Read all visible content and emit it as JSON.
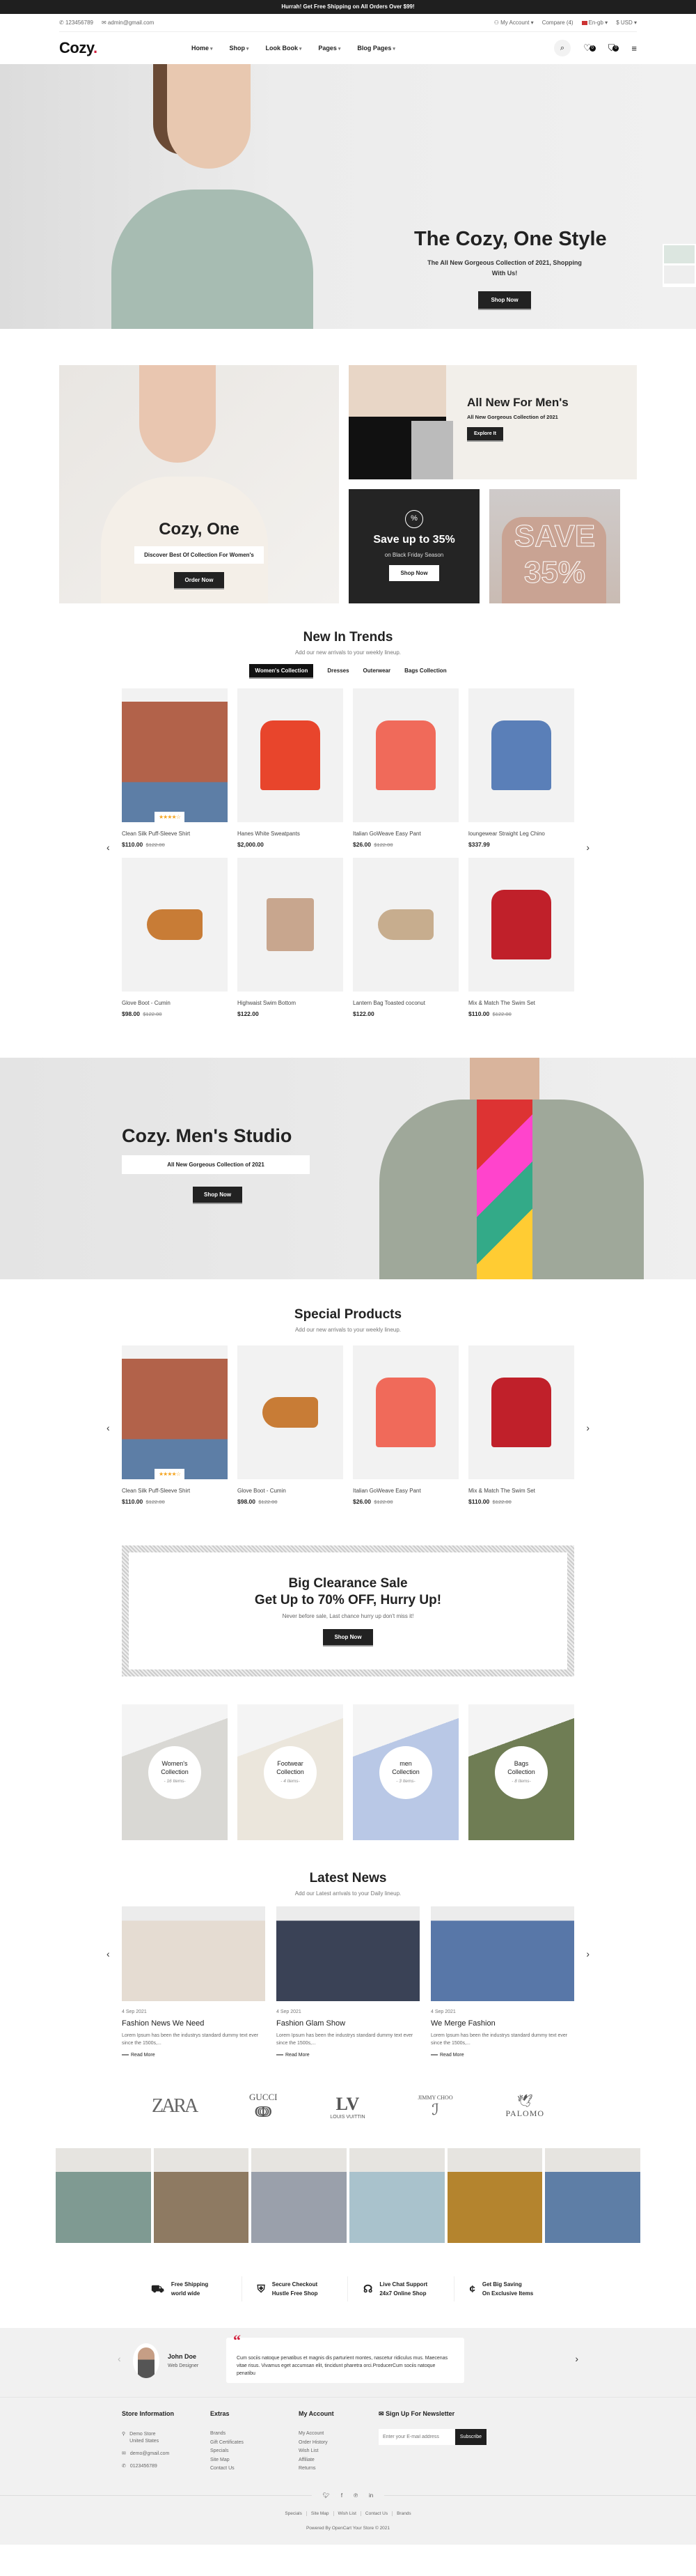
{
  "topbar": {
    "promo": "Hurrah! Get Free Shipping on All Orders Over $99!"
  },
  "infobar": {
    "phone": "123456789",
    "email": "admin@gmail.com",
    "account": "My Account ▾",
    "compare": "Compare (4)",
    "language": "En-gb ▾",
    "currency": "$ USD ▾"
  },
  "header": {
    "logo": "Cozy",
    "logo_dot": ".",
    "nav": [
      "Home",
      "Shop",
      "Look Book",
      "Pages",
      "Blog Pages"
    ],
    "wishlist_count": "0",
    "cart_count": "0"
  },
  "hero": {
    "title": "The Cozy, One Style",
    "subtitle": "The All New Gorgeous Collection of 2021, Shopping With Us!",
    "button": "Shop Now"
  },
  "banners": {
    "women": {
      "title": "Cozy, One",
      "tagline": "Discover Best Of Collection For Women's",
      "button": "Order Now"
    },
    "men": {
      "title": "All New For Men's",
      "tagline": "All New Gorgeous Collection of 2021",
      "button": "Explore It"
    },
    "sale": {
      "icon": "%",
      "title": "Save up to 35%",
      "tagline": "on Black Friday Season",
      "button": "Shop Now"
    },
    "save": {
      "text_line1": "SAVE",
      "text_line2": "35%"
    }
  },
  "trends": {
    "title": "New In Trends",
    "subtitle": "Add our new arrivals to your weekly lineup.",
    "tabs": [
      "Women's Collection",
      "Dresses",
      "Outerwear",
      "Bags Collection"
    ],
    "active_tab": 0,
    "products": [
      {
        "name": "Clean Silk Puff-Sleeve Shirt",
        "price": "$110.00",
        "old_price": "$122.00",
        "rating": "★★★★☆",
        "color": "#b2624a",
        "kind": "person"
      },
      {
        "name": "Hanes White Sweatpants",
        "price": "$2,000.00",
        "old_price": "",
        "color": "#e8452c",
        "kind": "shirt"
      },
      {
        "name": "Italian GoWeave Easy Pant",
        "price": "$26.00",
        "old_price": "$122.00",
        "color": "#f06a5a",
        "kind": "shirt"
      },
      {
        "name": "loungewear Straight Leg Chino",
        "price": "$337.99",
        "old_price": "",
        "color": "#5a7fb8",
        "kind": "shirt"
      },
      {
        "name": "Glove Boot - Cumin",
        "price": "$98.00",
        "old_price": "$122.00",
        "color": "#c87c36",
        "kind": "shoe"
      },
      {
        "name": "Highwaist Swim Bottom",
        "price": "$122.00",
        "old_price": "",
        "color": "#c8a68e",
        "kind": "bag"
      },
      {
        "name": "Lantern Bag Toasted coconut",
        "price": "$122.00",
        "old_price": "",
        "color": "#c7ad8e",
        "kind": "shoe"
      },
      {
        "name": "Mix & Match The Swim Set",
        "price": "$110.00",
        "old_price": "$122.00",
        "color": "#c0202a",
        "kind": "shirt"
      }
    ]
  },
  "studio": {
    "title": "Cozy. Men's Studio",
    "tagline": "All New Gorgeous Collection of 2021",
    "button": "Shop Now"
  },
  "special": {
    "title": "Special Products",
    "subtitle": "Add our new arrivals to your weekly lineup.",
    "products": [
      {
        "name": "Clean Silk Puff-Sleeve Shirt",
        "price": "$110.00",
        "old_price": "$122.00",
        "rating": "★★★★☆",
        "color": "#b2624a",
        "kind": "person"
      },
      {
        "name": "Glove Boot - Cumin",
        "price": "$98.00",
        "old_price": "$122.00",
        "color": "#c87c36",
        "kind": "shoe"
      },
      {
        "name": "Italian GoWeave Easy Pant",
        "price": "$26.00",
        "old_price": "$122.00",
        "color": "#f06a5a",
        "kind": "shirt"
      },
      {
        "name": "Mix & Match The Swim Set",
        "price": "$110.00",
        "old_price": "$122.00",
        "color": "#c0202a",
        "kind": "shirt"
      }
    ]
  },
  "clearance": {
    "line1": "Big Clearance Sale",
    "line2": "Get Up to 70% OFF, Hurry Up!",
    "subtitle": "Never before sale, Last chance hurry up don't miss it!",
    "button": "Shop Now"
  },
  "categories": [
    {
      "name1": "Women's",
      "name2": "Collection",
      "count": "- 16 Items-",
      "bg": "#d9d8d4"
    },
    {
      "name1": "Footwear",
      "name2": "Collection",
      "count": "- 4 Items-",
      "bg": "#ebe6dc"
    },
    {
      "name1": "men",
      "name2": "Collection",
      "count": "- 3 Items-",
      "bg": "#b9c8e6"
    },
    {
      "name1": "Bags",
      "name2": "Collection",
      "count": "- 8 Items-",
      "bg": "#6f7d54"
    }
  ],
  "news": {
    "title": "Latest News",
    "subtitle": "Add our Latest arrivals to your Daily lineup.",
    "posts": [
      {
        "date": "4 Sep 2021",
        "title": "Fashion News We Need",
        "excerpt": "Lorem Ipsum has been the industrys standard dummy text ever since the 1500s,...",
        "more": "Read More",
        "color": "#e5dcd2"
      },
      {
        "date": "4 Sep 2021",
        "title": "Fashion Glam Show",
        "excerpt": "Lorem Ipsum has been the industrys standard dummy text ever since the 1500s,...",
        "more": "Read More",
        "color": "#3a4256"
      },
      {
        "date": "4 Sep 2021",
        "title": "We Merge Fashion",
        "excerpt": "Lorem Ipsum has been the industrys standard dummy text ever since the 1500s,...",
        "more": "Read More",
        "color": "#5877a8"
      }
    ]
  },
  "brands": [
    "ZARA",
    "GUCCI",
    "LOUIS VUITTIN",
    "JIMMY CHOO",
    "PALOMO"
  ],
  "instagram": [
    "#7f9a92",
    "#8e7a62",
    "#9aa0ab",
    "#a9c2cc",
    "#b4842e",
    "#5e7ea6"
  ],
  "features": [
    {
      "icon": "truck",
      "line1": "Free Shipping",
      "line2": "world wide"
    },
    {
      "icon": "shield",
      "line1": "Secure Checkout",
      "line2": "Hustle Free Shop"
    },
    {
      "icon": "headset",
      "line1": "Live Chat Support",
      "line2": "24x7 Online Shop"
    },
    {
      "icon": "piggy",
      "line1": "Get Big Saving",
      "line2": "On Exclusive Items"
    }
  ],
  "testimonial": {
    "name": "John Doe",
    "role": "Web Designer",
    "quote": "Cum sociis natoque penatibus et magnis dis parturient montes, nascetur ridiculus mus. Maecenas vitae risus. Vivamus eget accumsan elit, tincidunt pharetra orci.ProducerCum sociis natoque penatibu"
  },
  "footer": {
    "store": {
      "title": "Store Information",
      "address1": "Demo Store",
      "address2": "United States",
      "email": "demo@gmail.com",
      "phone": "0123456789"
    },
    "extras": {
      "title": "Extras",
      "links": [
        "Brands",
        "Gift Certificates",
        "Specials",
        "Site Map",
        "Contact Us"
      ]
    },
    "account": {
      "title": "My Account",
      "links": [
        "My Account",
        "Order History",
        "Wish List",
        "Affiliate",
        "Returns"
      ]
    },
    "newsletter": {
      "title": "Sign Up For Newsletter",
      "placeholder": "Enter your E-mail address",
      "button": "Subscribe"
    },
    "bottom_links": [
      "Specials",
      "Site Map",
      "Wish List",
      "Contact Us",
      "Brands"
    ],
    "powered": "Powered By OpenCart Your Store © 2021"
  }
}
